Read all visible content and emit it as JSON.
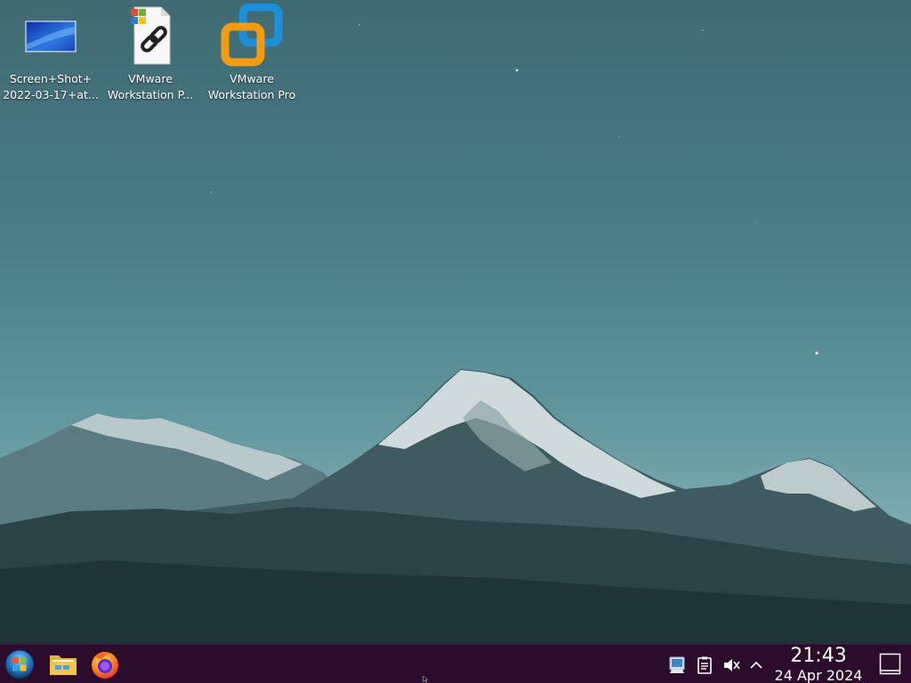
{
  "desktop": {
    "icons": [
      {
        "label_line1": "Screen+Shot+",
        "label_line2": "2022-03-17+at...",
        "icon": "image-file-icon"
      },
      {
        "label_line1": "VMware",
        "label_line2": "Workstation P...",
        "icon": "windows-shortcut-icon"
      },
      {
        "label_line1": "VMware",
        "label_line2": "Workstation Pro",
        "icon": "vmware-icon"
      }
    ]
  },
  "taskbar": {
    "launchers": [
      {
        "icon": "start-menu-icon"
      },
      {
        "icon": "file-manager-icon"
      },
      {
        "icon": "firefox-icon"
      }
    ],
    "tray": [
      {
        "icon": "network-icon"
      },
      {
        "icon": "clipboard-icon"
      },
      {
        "icon": "volume-muted-icon"
      },
      {
        "icon": "chevron-up-icon"
      }
    ],
    "clock": {
      "time": "21:43",
      "date": "24 Apr 2024"
    },
    "show_desktop_icon": "show-desktop-icon"
  },
  "colors": {
    "taskbar_bg": "#2b0d2b",
    "sky_top": "#3f6a72",
    "sky_bottom": "#7aa9ae",
    "mountain_dark": "#1f3436",
    "snow": "#dfe8ea"
  }
}
